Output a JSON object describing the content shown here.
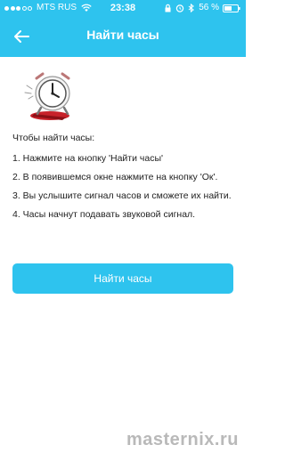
{
  "status_bar": {
    "carrier": "MTS RUS",
    "time": "23:38",
    "battery": "56 %"
  },
  "nav": {
    "title": "Найти часы",
    "back_icon": "arrow-left-icon"
  },
  "instructions": {
    "intro": "Чтобы найти часы:",
    "steps": [
      "1. Нажмите на кнопку 'Найти часы'",
      " 2. В появившемся окне нажмите на кнопку 'Ок'.",
      "3. Вы услышите сигнал часов и сможете их найти.",
      "4. Часы начнут подавать звуковой сигнал."
    ]
  },
  "find_button": {
    "label": "Найти часы"
  },
  "watermark": "masternix.ru",
  "colors": {
    "accent": "#2ec3ee"
  }
}
